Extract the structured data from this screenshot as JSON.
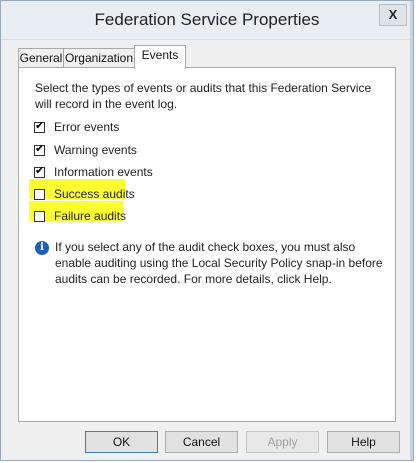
{
  "window": {
    "title": "Federation Service Properties",
    "close_glyph": "X"
  },
  "tabs": [
    {
      "label": "General"
    },
    {
      "label": "Organization"
    },
    {
      "label": "Events"
    }
  ],
  "events": {
    "description": "Select the types of events or audits that this Federation Service will record in the event log.",
    "items": [
      {
        "label": "Error events",
        "checked": true
      },
      {
        "label": "Warning events",
        "checked": true
      },
      {
        "label": "Information events",
        "checked": true
      },
      {
        "label": "Success audits",
        "checked": false,
        "highlighted": true
      },
      {
        "label": "Failure audits",
        "checked": false,
        "highlighted": true
      }
    ],
    "info_text": "If you select any of the audit check boxes, you must also enable auditing using the Local Security Policy snap-in before audits can be recorded. For more details, click Help.",
    "info_icon": "info-icon"
  },
  "buttons": [
    {
      "label": "OK",
      "enabled": true
    },
    {
      "label": "Cancel",
      "enabled": true
    },
    {
      "label": "Apply",
      "enabled": false
    },
    {
      "label": "Help",
      "enabled": true
    }
  ],
  "colors": {
    "highlight": "#fbff31",
    "info_icon": "#1f5fb8"
  }
}
